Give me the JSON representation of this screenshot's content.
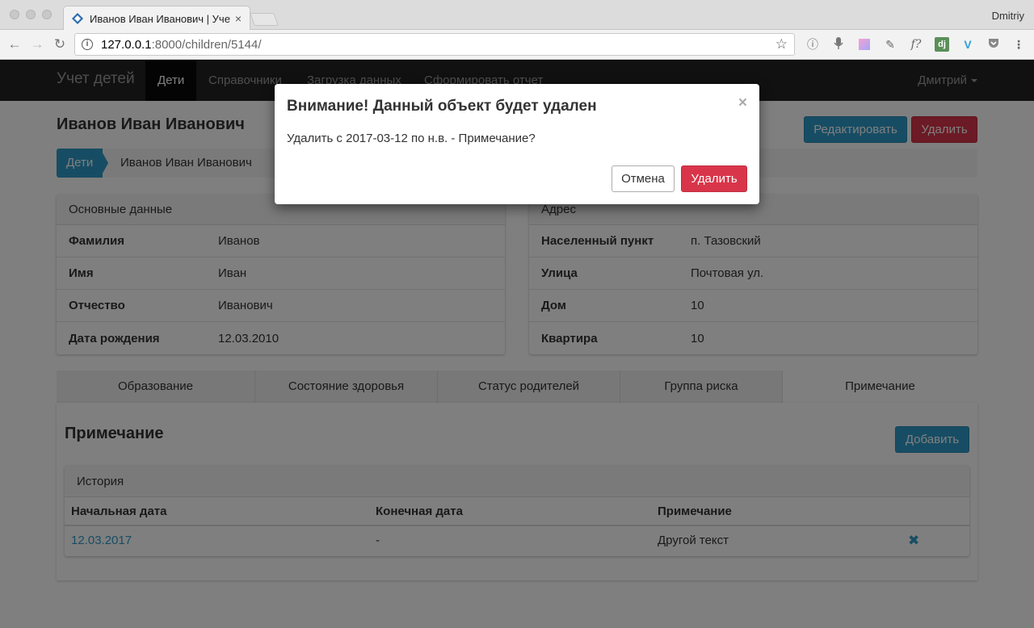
{
  "browser": {
    "tab_title": "Иванов Иван Иванович | Учет",
    "tab_close": "×",
    "profile_name": "Dmitriy",
    "url_host": "127.0.0.1",
    "url_rest": ":8000/children/5144/"
  },
  "navbar": {
    "brand": "Учет детей",
    "links": [
      "Дети",
      "Справочники",
      "Загрузка данных",
      "Сформировать отчет"
    ],
    "user": "Дмитрий"
  },
  "page": {
    "title": "Иванов Иван Иванович",
    "edit_button": "Редактировать",
    "delete_button": "Удалить",
    "breadcrumb_root": "Дети",
    "breadcrumb_current": "Иванов Иван Иванович"
  },
  "basic": {
    "heading": "Основные данные",
    "rows": [
      {
        "key": "Фамилия",
        "value": "Иванов"
      },
      {
        "key": "Имя",
        "value": "Иван"
      },
      {
        "key": "Отчество",
        "value": "Иванович"
      },
      {
        "key": "Дата рождения",
        "value": "12.03.2010"
      }
    ]
  },
  "address": {
    "heading": "Адрес",
    "rows": [
      {
        "key": "Населенный пункт",
        "value": "п. Тазовский"
      },
      {
        "key": "Улица",
        "value": "Почтовая ул."
      },
      {
        "key": "Дом",
        "value": "10"
      },
      {
        "key": "Квартира",
        "value": "10"
      }
    ]
  },
  "tabs": [
    "Образование",
    "Состояние здоровья",
    "Статус родителей",
    "Группа риска",
    "Примечание"
  ],
  "note": {
    "title": "Примечание",
    "add_button": "Добавить",
    "history_heading": "История",
    "columns": [
      "Начальная дата",
      "Конечная дата",
      "Примечание"
    ],
    "rows": [
      {
        "start": "12.03.2017",
        "end": "-",
        "note": "Другой текст",
        "delete": "✖"
      }
    ]
  },
  "modal": {
    "title": "Внимание! Данный объект будет удален",
    "close": "×",
    "message": "Удалить с 2017-03-12 по н.в. - Примечание?",
    "cancel": "Отмена",
    "confirm": "Удалить"
  },
  "colors": {
    "primary": "#2e9ac9",
    "danger": "#d9354a",
    "navbar": "#222222"
  }
}
